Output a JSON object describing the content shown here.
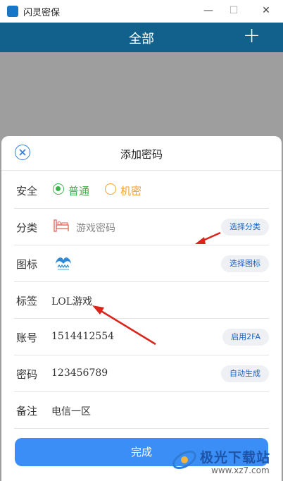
{
  "window": {
    "title": "闪灵密保",
    "minimize_glyph": "—",
    "maximize_glyph": "☐",
    "close_glyph": "✕"
  },
  "header": {
    "title": "全部",
    "add_glyph": "+"
  },
  "dialog": {
    "title": "添加密码",
    "close_icon": "close-icon",
    "rows": {
      "security": {
        "label": "安全",
        "options": [
          {
            "label": "普通",
            "selected": true,
            "color": "#3cb04c"
          },
          {
            "label": "机密",
            "selected": false,
            "color": "#f0a12b"
          }
        ]
      },
      "category": {
        "label": "分类",
        "value": "游戏密码",
        "icon": "bed-icon",
        "action": "选择分类"
      },
      "icon": {
        "label": "图标",
        "icon": "game-logo-icon",
        "action": "选择图标"
      },
      "tag": {
        "label": "标签",
        "value": "LOL游戏"
      },
      "account": {
        "label": "账号",
        "value": "1514412554",
        "action": "启用2FA"
      },
      "password": {
        "label": "密码",
        "value": "123456789",
        "action": "自动生成"
      },
      "note": {
        "label": "备注",
        "value": "电信一区"
      }
    },
    "submit_label": "完成"
  },
  "watermark": {
    "text": "极光下载站",
    "url": "www.xz7.com"
  },
  "colors": {
    "titlebar_bg": "#ffffff",
    "header_bg": "#11618c",
    "overlay": "#9e9e9e",
    "accent": "#3a8ef6",
    "annotation_arrow": "#d9251c"
  }
}
